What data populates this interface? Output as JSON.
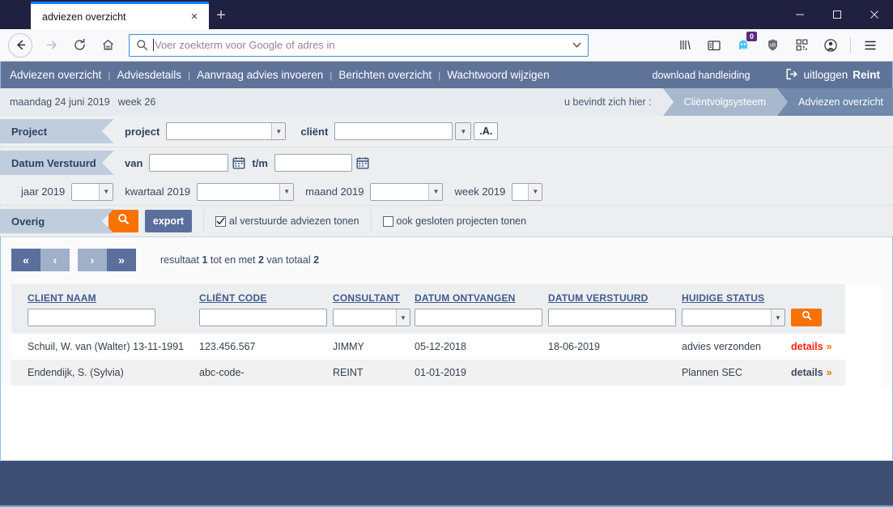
{
  "browser": {
    "tab_title": "adviezen overzicht",
    "new_tab_label": "+",
    "close_label": "×",
    "url_placeholder": "Voer zoekterm voor Google of adres in",
    "container_badge": "0",
    "icons": {
      "back": "back-arrow-icon",
      "forward": "forward-arrow-icon",
      "reload": "reload-icon",
      "home": "home-icon",
      "library": "library-icon",
      "sidebar": "sidebar-icon",
      "containers": "containers-ghost-icon",
      "shield": "ublock-shield-icon",
      "qr": "qr-code-icon",
      "account": "account-icon",
      "menu": "hamburger-menu-icon"
    }
  },
  "topnav": {
    "items": [
      {
        "label": "Adviezen overzicht"
      },
      {
        "label": "Adviesdetails"
      },
      {
        "label": "Aanvraag advies invoeren"
      },
      {
        "label": "Berichten overzicht"
      },
      {
        "label": "Wachtwoord wijzigen"
      }
    ],
    "separator": "|",
    "download_link": "download handleiding",
    "logout_label": "uitloggen",
    "logout_user": "Reint"
  },
  "subbar": {
    "date": "maandag 24 juni 2019",
    "week": "week 26",
    "breadcrumb_lead": "u bevindt zich hier :",
    "breadcrumbs": [
      {
        "label": "Cliëntvolgsysteem"
      },
      {
        "label": "Adviezen overzicht"
      }
    ]
  },
  "filters": {
    "project": {
      "tab_label": "Project",
      "project_label": "project",
      "project_value": "",
      "client_label": "cliënt",
      "client_value": "",
      "alpha_button": ".A."
    },
    "datum": {
      "tab_label": "Datum Verstuurd",
      "van_label": "van",
      "van_value": "",
      "tm_label": "t/m",
      "tm_value": "",
      "jaar_label": "jaar 2019",
      "jaar_value": "",
      "kwartaal_label": "kwartaal 2019",
      "kwartaal_value": "",
      "maand_label": "maand 2019",
      "maand_value": "",
      "week_label": "week 2019",
      "week_value": ""
    },
    "overig": {
      "tab_label": "Overig",
      "search_button": "search-icon",
      "export_button": "export",
      "checkbox1_label": "al verstuurde adviezen tonen",
      "checkbox1_checked": "✓",
      "checkbox2_label": "ook gesloten projecten tonen",
      "checkbox2_checked": ""
    }
  },
  "pager": {
    "first": "«",
    "prev": "‹",
    "next": "›",
    "last": "»",
    "result_prefix": "resultaat",
    "result_from": "1",
    "result_mid": "tot en met",
    "result_to": "2",
    "result_of": "van totaal",
    "result_total": "2"
  },
  "table": {
    "headers": [
      "CLIENT NAAM",
      "CLIËNT CODE",
      "CONSULTANT",
      "DATUM ONTVANGEN",
      "DATUM VERSTUURD",
      "HUIDIGE STATUS"
    ],
    "filter_values": {
      "client_naam": "",
      "client_code": "",
      "consultant": "",
      "datum_ontvangen": "",
      "datum_verstuurd": "",
      "huidige_status": ""
    },
    "search_button": "search-icon",
    "rows": [
      {
        "client_naam": "Schuil, W. van (Walter) 13-11-1991",
        "client_code": "123.456.567",
        "consultant": "JIMMY",
        "datum_ontvangen": "05-12-2018",
        "datum_verstuurd": "18-06-2019",
        "huidige_status": "advies verzonden",
        "details_label": "details",
        "details_chevron": "»"
      },
      {
        "client_naam": "Endendijk, S. (Sylvia)",
        "client_code": "abc-code-",
        "consultant": "REINT",
        "datum_ontvangen": "01-01-2019",
        "datum_verstuurd": "",
        "huidige_status": "Plannen SEC",
        "details_label": "details",
        "details_chevron": "»"
      }
    ]
  },
  "colors": {
    "titlebar": "#202040",
    "topnav": "#5f7399",
    "accent_orange": "#f97200",
    "button_blue": "#5a6f9c",
    "footer": "#3e4f73",
    "link_red": "#ff2a1a",
    "crumb_light": "#a8b8cd",
    "crumb_dark": "#7089ad"
  }
}
